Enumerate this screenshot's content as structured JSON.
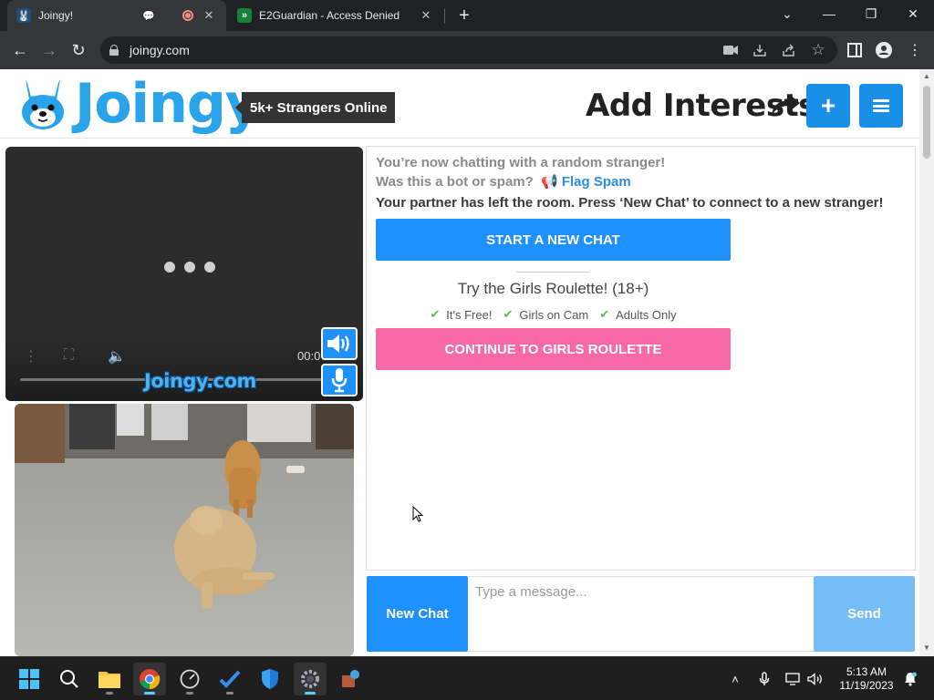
{
  "browser": {
    "tabs": [
      {
        "title": "Joingy!",
        "active": true
      },
      {
        "title": "E2Guardian - Access Denied",
        "active": false
      }
    ],
    "url": "joingy.com"
  },
  "site": {
    "logo_text": "Joingy",
    "online_badge": "5k+ Strangers Online",
    "add_interests": "Add Interests",
    "plus_symbol": "+"
  },
  "video": {
    "time": "00:0",
    "watermark": "Joingy.com"
  },
  "chat": {
    "status_line": "You’re now chatting with a random stranger!",
    "bot_question": "Was this a bot or spam?",
    "flag_spam": "Flag Spam",
    "partner_left": "Your partner has left the room. Press ‘New Chat’ to connect to a new stranger!",
    "start_new_chat": "START A NEW CHAT",
    "girls_title": "Try the Girls Roulette! (18+)",
    "features": [
      "It's Free!",
      "Girls on Cam",
      "Adults Only"
    ],
    "girls_button": "CONTINUE TO GIRLS ROULETTE"
  },
  "input": {
    "new_chat": "New Chat",
    "placeholder": "Type a message...",
    "send": "Send"
  },
  "taskbar": {
    "time": "5:13 AM",
    "date": "11/19/2023"
  },
  "colors": {
    "brand_blue": "#1e90ff",
    "pink": "#f86aa7",
    "send_light_blue": "#76bdf5"
  }
}
